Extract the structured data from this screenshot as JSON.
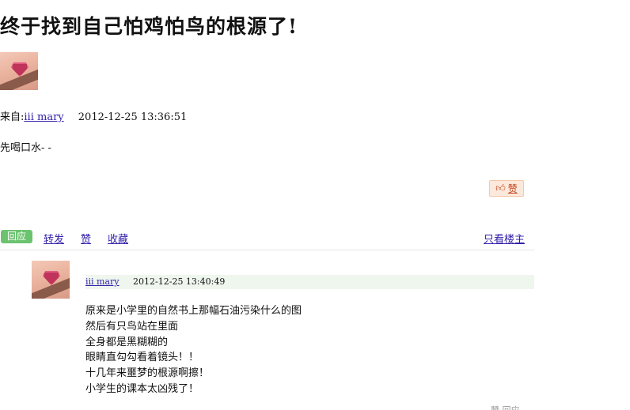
{
  "post": {
    "title": "终于找到自己怕鸡怕鸟的根源了!",
    "from_label": "来自:",
    "author": "iii mary",
    "time": "2012-12-25 13:36:51",
    "content": "先喝口水- -",
    "like_label": "赞"
  },
  "actions": {
    "reply": "回应",
    "share": "转发",
    "like": "赞",
    "collect": "收藏",
    "only_op": "只看楼主"
  },
  "comment": {
    "author": "iii mary",
    "time": "2012-12-25 13:40:49",
    "lines": [
      "原来是小学里的自然书上那幅石油污染什么的图",
      "然后有只鸟站在里面",
      "全身都是黑糊糊的",
      "眼睛直勾勾看着镜头！！",
      "十几年来噩梦的根源啊擦！",
      "小学生的课本太凶残了！"
    ],
    "footer_partial": "赞  回应"
  },
  "colors": {
    "link": "#3322aa",
    "reply_green": "#6cc36f",
    "like_bg": "#fde9dc"
  }
}
